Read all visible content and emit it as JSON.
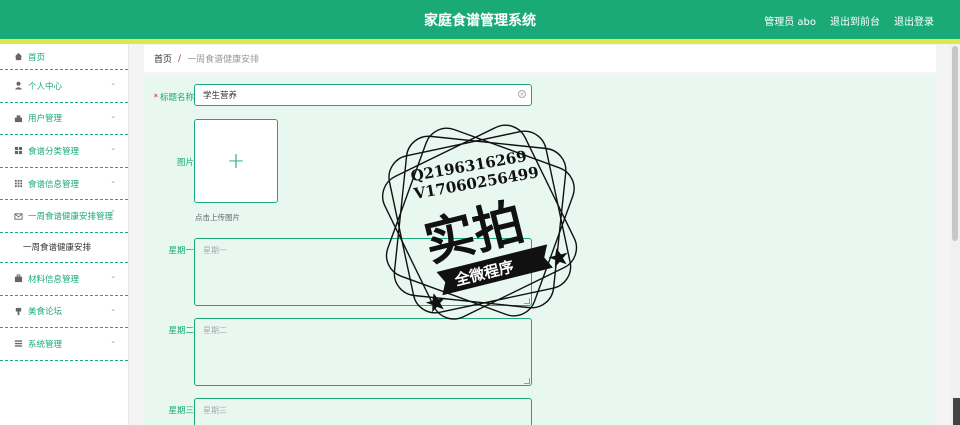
{
  "header": {
    "title": "家庭食谱管理系统",
    "links": [
      "管理员 abo",
      "退出到前台",
      "退出登录"
    ]
  },
  "sidebar": {
    "items": [
      {
        "label": "首页",
        "icon": "home-icon",
        "chevron": false
      },
      {
        "label": "个人中心",
        "icon": "user-icon",
        "chevron": true
      },
      {
        "label": "用户管理",
        "icon": "users-icon",
        "chevron": true
      },
      {
        "label": "食谱分类管理",
        "icon": "grid-icon",
        "chevron": true
      },
      {
        "label": "食谱信息管理",
        "icon": "apps-icon",
        "chevron": true
      },
      {
        "label": "一周食谱健康安排管理",
        "icon": "mail-icon",
        "chevron": "up"
      },
      {
        "label": "材料信息管理",
        "icon": "briefcase-icon",
        "chevron": true
      },
      {
        "label": "美食论坛",
        "icon": "cup-icon",
        "chevron": true
      },
      {
        "label": "系统管理",
        "icon": "list-icon",
        "chevron": true
      }
    ],
    "subitem": "一周食谱健康安排"
  },
  "breadcrumb": {
    "home": "首页",
    "separator": "/",
    "current": "一周食谱健康安排"
  },
  "form": {
    "title_label": "标题名称",
    "title_required": "*",
    "title_value": "学生营养",
    "image_label": "图片",
    "upload_hint": "点击上传图片",
    "monday_label": "星期一",
    "monday_placeholder": "星期一",
    "tuesday_label": "星期二",
    "tuesday_placeholder": "星期二",
    "wednesday_label": "星期三",
    "wednesday_placeholder": "星期三"
  },
  "watermark": {
    "line1": "Q2196316269",
    "line2": "V17060256499",
    "big": "实拍",
    "banner": "全微程序"
  },
  "colors": {
    "primary": "#1aaa78",
    "accent": "#dde84a",
    "required": "#e11144"
  }
}
